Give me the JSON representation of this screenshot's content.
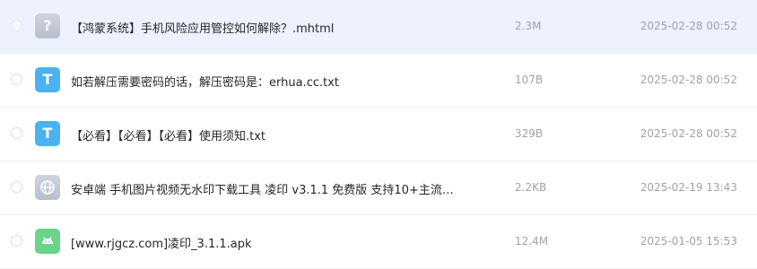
{
  "files": [
    {
      "name": "【鸿蒙系统】手机风险应用管控如何解除？.mhtml",
      "size": "2.3M",
      "date": "2025-02-28 00:52",
      "icon": "unknown-file-icon",
      "icon_glyph": "?",
      "selected": true
    },
    {
      "name": "如若解压需要密码的话，解压密码是：erhua.cc.txt",
      "size": "107B",
      "date": "2025-02-28 00:52",
      "icon": "text-file-icon",
      "icon_glyph": "T",
      "selected": false
    },
    {
      "name": "【必看】【必看】【必看】使用须知.txt",
      "size": "329B",
      "date": "2025-02-28 00:52",
      "icon": "text-file-icon",
      "icon_glyph": "T",
      "selected": false
    },
    {
      "name": "安卓端 手机图片视频无水印下载工具 凌印 v3.1.1 免费版 支持10+主流…",
      "size": "2.2KB",
      "date": "2025-02-19 13:43",
      "icon": "web-link-icon",
      "icon_glyph": "",
      "selected": false
    },
    {
      "name": "[www.rjgcz.com]凌印_3.1.1.apk",
      "size": "12.4M",
      "date": "2025-01-05 15:53",
      "icon": "android-apk-icon",
      "icon_glyph": "",
      "selected": false
    }
  ],
  "colors": {
    "selected_row": "#eef2fe",
    "txt_icon": "#4ab2f0",
    "apk_icon": "#6bd38a",
    "generic_icon": "#c4cad6"
  }
}
